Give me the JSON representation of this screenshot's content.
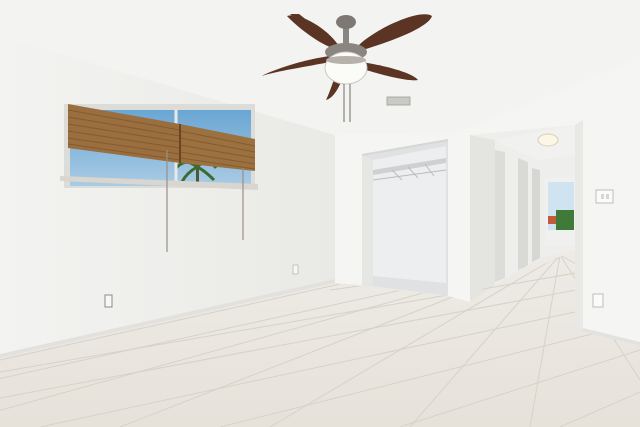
{
  "colors": {
    "ceiling": "#f2f2f0",
    "wall_left": "#f0f0ee",
    "wall_right": "#f5f5f3",
    "tile": "#ece9e3",
    "grout": "#d8d4cc",
    "fan_blade": "#5b3423",
    "fan_metal": "#8a8580",
    "bamboo": "#9a6e3e",
    "sky": "#7fb3d8",
    "closet": "#eceeef"
  }
}
